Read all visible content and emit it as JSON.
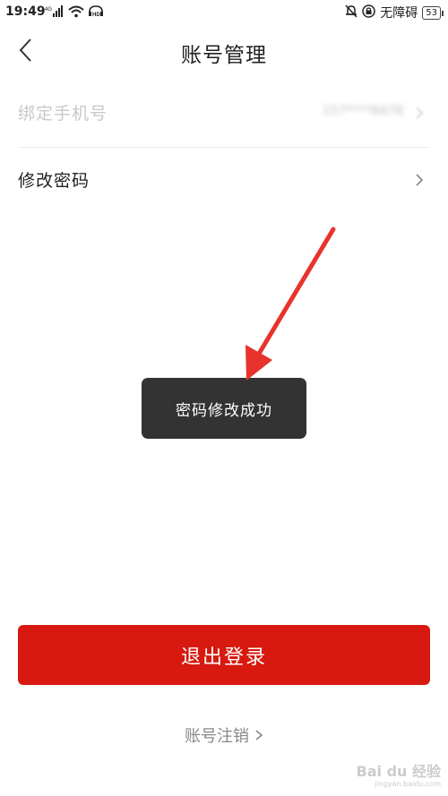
{
  "status_bar": {
    "time": "19:49",
    "network_label": "4G",
    "hd_label": "HD",
    "accessibility_label": "无障碍",
    "battery": "53"
  },
  "header": {
    "title": "账号管理"
  },
  "settings": {
    "bind_phone": {
      "label": "绑定手机号",
      "value": "157****8478"
    },
    "change_password": {
      "label": "修改密码"
    }
  },
  "toast": {
    "message": "密码修改成功"
  },
  "actions": {
    "logout_label": "退出登录",
    "cancel_account_label": "账号注销"
  },
  "watermark": {
    "brand": "Bai du 经验",
    "url": "jingyan.baidu.com"
  },
  "colors": {
    "primary_red": "#d7190f",
    "toast_bg": "#333333",
    "annotation_arrow": "#e8332c"
  }
}
